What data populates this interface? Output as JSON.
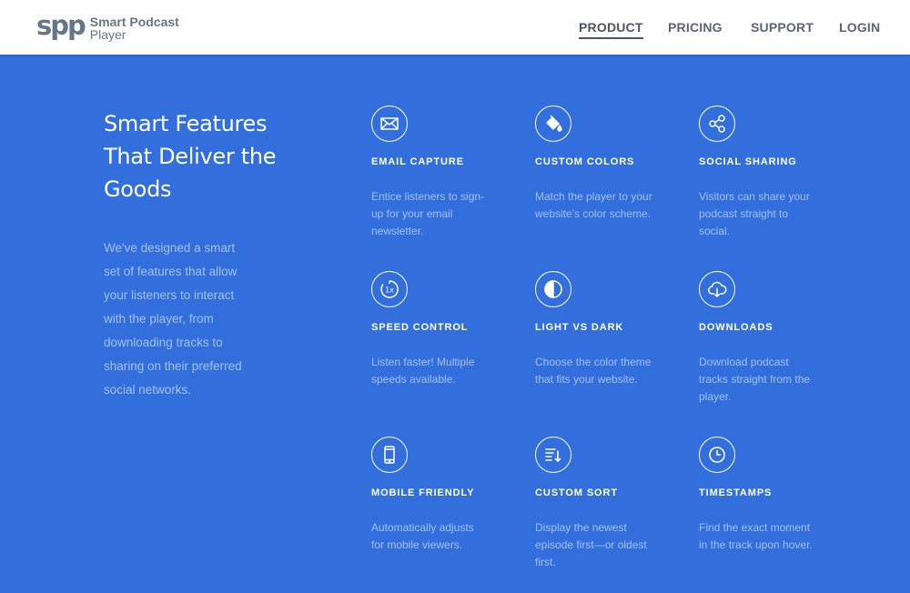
{
  "brand": {
    "mark": "spp",
    "line1": "Smart Podcast",
    "line2": "Player"
  },
  "nav": [
    {
      "label": "PRODUCT",
      "active": true
    },
    {
      "label": "PRICING",
      "active": false
    },
    {
      "label": "SUPPORT",
      "active": false
    },
    {
      "label": "LOGIN",
      "active": false
    }
  ],
  "intro": {
    "heading": "Smart Features That Deliver the Goods",
    "body": "We've designed a smart set of features that allow your listeners to interact with the player, from downloading tracks to sharing on their preferred social networks."
  },
  "features": [
    {
      "icon": "envelope-icon",
      "title": "EMAIL CAPTURE",
      "desc": "Entice listeners to sign-up for your email newsletter."
    },
    {
      "icon": "paint-bucket-icon",
      "title": "CUSTOM COLORS",
      "desc": "Match the player to your website's color scheme."
    },
    {
      "icon": "share-icon",
      "title": "SOCIAL SHARING",
      "desc": "Visitors can share your podcast straight to social."
    },
    {
      "icon": "speed-icon",
      "title": "SPEED CONTROL",
      "desc": "Listen faster! Multiple speeds available."
    },
    {
      "icon": "contrast-icon",
      "title": "LIGHT VS DARK",
      "desc": "Choose the color theme that fits your website."
    },
    {
      "icon": "cloud-download-icon",
      "title": "DOWNLOADS",
      "desc": "Download podcast tracks straight from the player."
    },
    {
      "icon": "mobile-icon",
      "title": "MOBILE FRIENDLY",
      "desc": "Automatically adjusts for mobile viewers."
    },
    {
      "icon": "sort-icon",
      "title": "CUSTOM SORT",
      "desc": "Display the newest episode first—or oldest first."
    },
    {
      "icon": "clock-icon",
      "title": "TIMESTAMPS",
      "desc": "Find the exact moment in the track upon hover."
    }
  ],
  "speed_label": "1x",
  "colors": {
    "background": "#326fdd",
    "header": "#ffffff",
    "muted_text": "#a3c0f3",
    "nav_text": "#5b6575"
  }
}
